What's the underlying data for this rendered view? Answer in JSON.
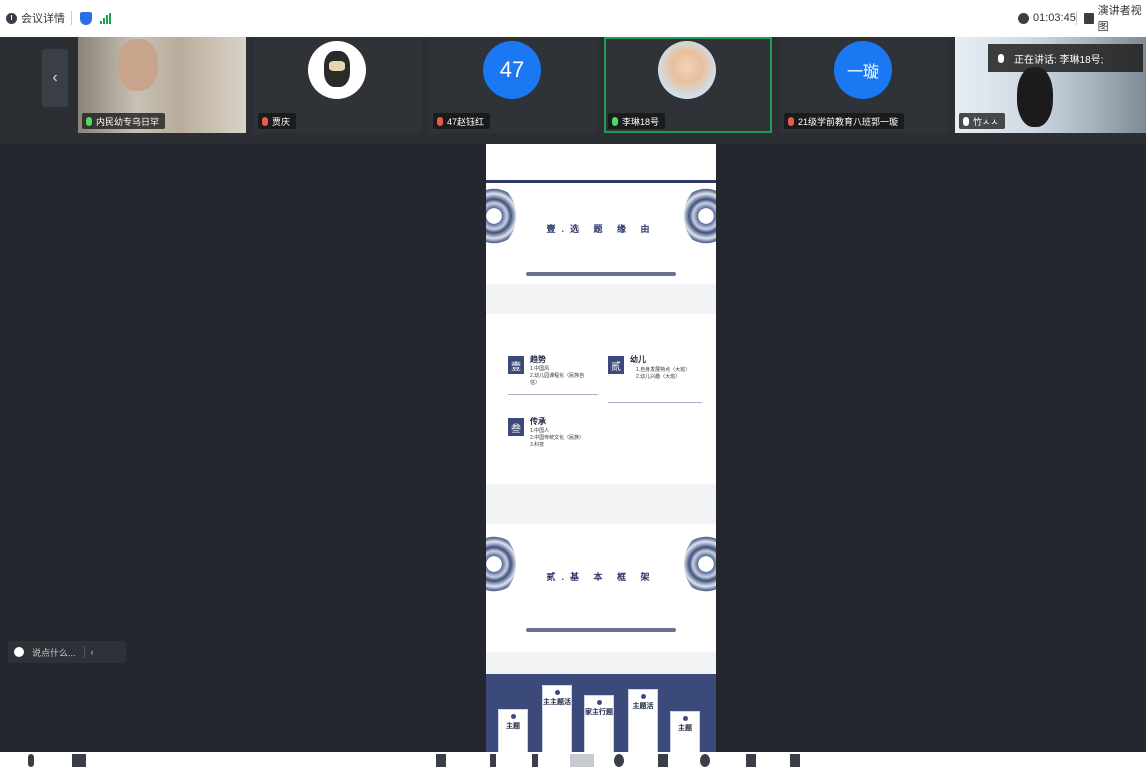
{
  "topbar": {
    "meeting_details": "会议详情",
    "timer": "01:03:45",
    "view_label": "演讲者视图"
  },
  "participants": [
    {
      "name": "内民幼专乌日罕",
      "avatar": "camera"
    },
    {
      "name": "贾庆",
      "avatar": "cartoon"
    },
    {
      "name": "47赵钰红",
      "avatar": "47"
    },
    {
      "name": "李琳18号",
      "avatar": "photo"
    },
    {
      "name": "21级学前教育八班郭一璇",
      "avatar": "一璇"
    },
    {
      "name": "竹ㅅㅅ",
      "avatar": "camera"
    }
  ],
  "speaking": "正在讲话: 李琳18号;",
  "chat": {
    "placeholder": "说点什么..."
  },
  "slides": {
    "s1_title": "壹.选 题 缘 由",
    "s2": {
      "c1_seal": "壹",
      "c1_title": "趋势",
      "c1_lines": [
        "1.中国风",
        "2.幼儿园课程化（民族自",
        "信）"
      ],
      "c2_seal": "贰",
      "c2_title": "幼儿",
      "c2_lines": [
        "1.自身发展特点（大班）",
        "2.幼儿兴趣（大班）"
      ],
      "c3_seal": "叁",
      "c3_title": "传承",
      "c3_lines": [
        "1.中国人",
        "2.中国传统文化（民族）",
        "3.科技"
      ]
    },
    "s3_title": "贰.基 本 框 架",
    "s4_tags": [
      "主题",
      "主主题活",
      "家主行题",
      "主题活",
      "主题"
    ]
  }
}
